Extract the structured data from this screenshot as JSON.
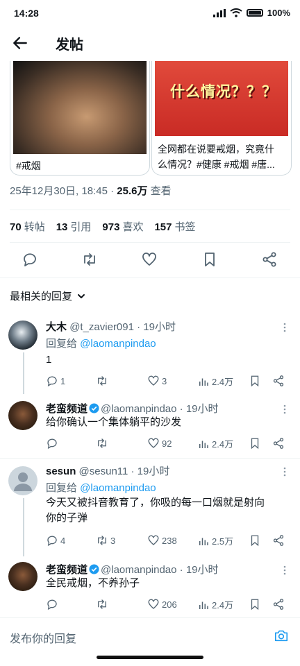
{
  "status": {
    "time": "14:28",
    "battery": "100%"
  },
  "header": {
    "title": "发帖"
  },
  "cards": [
    {
      "caption": "#戒烟"
    },
    {
      "overlay_text": "什么情况？？？",
      "caption_line1": "全网都在说要戒烟，究竟什",
      "caption_line2": "么情况？#健康 #戒烟 #唐..."
    }
  ],
  "post_meta": {
    "datetime": "25年12月30日, 18:45 · ",
    "views": "25.6万",
    "views_label": " 查看"
  },
  "stats": {
    "retweets": "70",
    "retweets_label": "转帖",
    "quotes": "13",
    "quotes_label": "引用",
    "likes": "973",
    "likes_label": "喜欢",
    "bookmarks": "157",
    "bookmarks_label": "书签"
  },
  "sort": {
    "label": "最相关的回复"
  },
  "replies": [
    {
      "name": "大木",
      "handle": "@t_zavier091 · 19小时",
      "reply_prefix": "回复给 ",
      "reply_to": "@laomanpindao",
      "text": "1",
      "replies": "1",
      "retweets": "",
      "likes": "3",
      "views": "2.4万"
    },
    {
      "name": "老蛮频道",
      "handle": "@laomanpindao · 19小时",
      "text": "给你确认一个集体躺平的沙发",
      "replies": "",
      "retweets": "",
      "likes": "92",
      "views": "2.4万"
    },
    {
      "name": "sesun",
      "handle": "@sesun11 · 19小时",
      "reply_prefix": "回复给 ",
      "reply_to": "@laomanpindao",
      "text_line1": "今天又被抖音教育了，你吸的每一口烟就是射向",
      "text_line2": "你的子弹",
      "replies": "4",
      "retweets": "3",
      "likes": "238",
      "views": "2.5万"
    },
    {
      "name": "老蛮频道",
      "handle": "@laomanpindao · 19小时",
      "text": "全民戒烟，不养孙子",
      "replies": "",
      "retweets": "",
      "likes": "206",
      "views": "2.4万"
    }
  ],
  "compose": {
    "placeholder": "发布你的回复"
  },
  "colors": {
    "accent": "#1d9bf0",
    "secondary_text": "#536471"
  }
}
